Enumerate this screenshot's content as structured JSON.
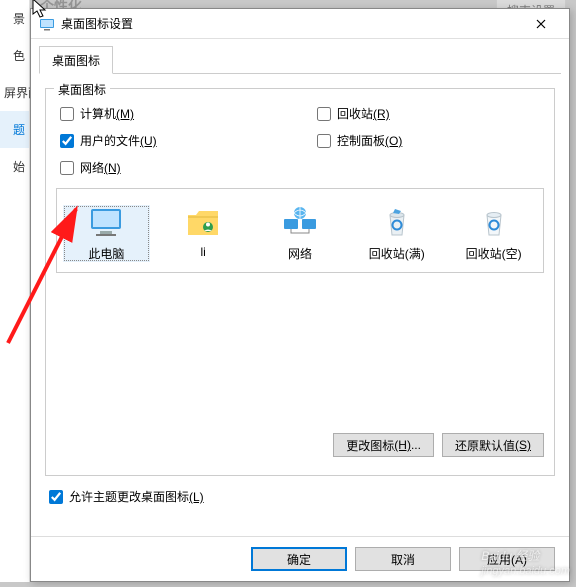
{
  "bg": {
    "items": [
      "景",
      "色",
      "屏界面",
      "题",
      "始"
    ],
    "truncated_top": "个性化",
    "truncated_right": "搜索设置"
  },
  "dialog": {
    "title": "桌面图标设置",
    "tab": "桌面图标",
    "group_legend": "桌面图标",
    "checks": {
      "computer": {
        "label": "计算机",
        "hot": "(M)",
        "checked": false
      },
      "recycle": {
        "label": "回收站",
        "hot": "(R)",
        "checked": false
      },
      "userdocs": {
        "label": "用户的文件",
        "hot": "(U)",
        "checked": true
      },
      "control": {
        "label": "控制面板",
        "hot": "(O)",
        "checked": false
      },
      "network": {
        "label": "网络",
        "hot": "(N)",
        "checked": false
      }
    },
    "icons": [
      {
        "name": "此电脑",
        "icon": "pc"
      },
      {
        "name": "li",
        "icon": "user"
      },
      {
        "name": "网络",
        "icon": "net"
      },
      {
        "name": "回收站(满)",
        "icon": "bin-full"
      },
      {
        "name": "回收站(空)",
        "icon": "bin-empty"
      }
    ],
    "change_icon": {
      "label": "更改图标",
      "hot": "(H)",
      "suffix": "..."
    },
    "restore_default": {
      "label": "还原默认值",
      "hot": "(S)"
    },
    "allow_themes": {
      "label": "允许主题更改桌面图标",
      "hot": "(L)",
      "checked": true
    },
    "ok": "确定",
    "cancel": "取消",
    "apply": "应用(A)"
  },
  "watermark": {
    "main": "Baidu 经验",
    "sub": "jingyan.baidu.com"
  }
}
